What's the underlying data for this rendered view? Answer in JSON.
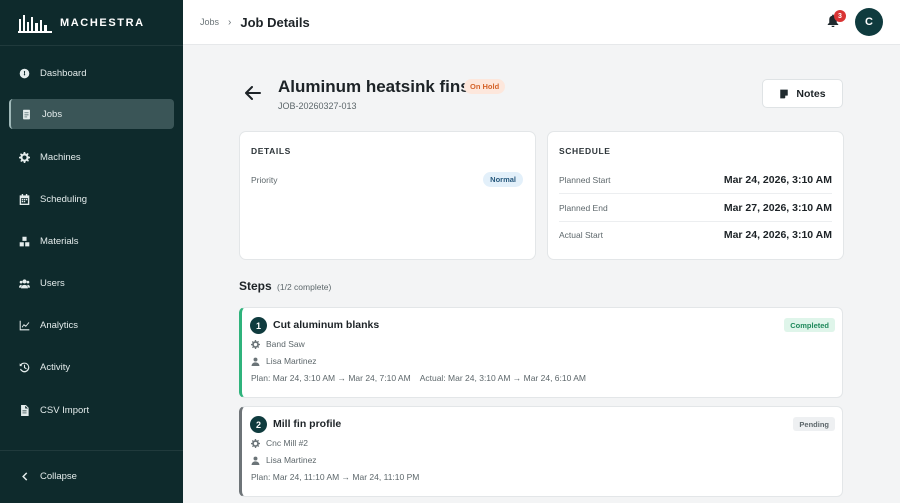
{
  "brand": {
    "name": "MACHESTRA",
    "logo_icon": "factory-skyline-icon"
  },
  "sidebar": {
    "items": [
      {
        "label": "Dashboard",
        "icon": "gauge-icon",
        "active": false
      },
      {
        "label": "Jobs",
        "icon": "clipboard-icon",
        "active": true
      },
      {
        "label": "Machines",
        "icon": "gear-icon",
        "active": false
      },
      {
        "label": "Scheduling",
        "icon": "calendar-icon",
        "active": false
      },
      {
        "label": "Materials",
        "icon": "boxes-icon",
        "active": false
      },
      {
        "label": "Users",
        "icon": "users-icon",
        "active": false
      },
      {
        "label": "Analytics",
        "icon": "chart-line-icon",
        "active": false
      },
      {
        "label": "Activity",
        "icon": "history-icon",
        "active": false
      },
      {
        "label": "CSV Import",
        "icon": "file-icon",
        "active": false
      }
    ],
    "collapse_label": "Collapse"
  },
  "topbar": {
    "breadcrumb_parent": "Jobs",
    "breadcrumb_current": "Job Details",
    "notification_count": "3",
    "avatar_initial": "C"
  },
  "job": {
    "title": "Aluminum heatsink fins",
    "status": "On Hold",
    "id": "JOB-20260327-013",
    "notes_label": "Notes"
  },
  "details": {
    "title": "DETAILS",
    "priority_label": "Priority",
    "priority_value": "Normal"
  },
  "schedule": {
    "title": "SCHEDULE",
    "rows": [
      {
        "label": "Planned Start",
        "value": "Mar 24, 2026, 3:10 AM"
      },
      {
        "label": "Planned End",
        "value": "Mar 27, 2026, 3:10 AM"
      },
      {
        "label": "Actual Start",
        "value": "Mar 24, 2026, 3:10 AM"
      }
    ]
  },
  "steps": {
    "heading": "Steps",
    "count": "(1/2 complete)",
    "items": [
      {
        "number": "1",
        "name": "Cut aluminum blanks",
        "status": "Completed",
        "machine": "Band Saw",
        "operator": "Lisa Martinez",
        "plan": "Plan: Mar 24, 3:10 AM → Mar 24, 7:10 AM",
        "actual": "Actual: Mar 24, 3:10 AM → Mar 24, 6:10 AM"
      },
      {
        "number": "2",
        "name": "Mill fin profile",
        "status": "Pending",
        "machine": "Cnc Mill #2",
        "operator": "Lisa Martinez",
        "plan": "Plan: Mar 24, 11:10 AM → Mar 24, 11:10 PM",
        "actual": ""
      }
    ]
  },
  "colors": {
    "sidebar_bg": "#0e2a2c",
    "accent": "#0f3b3e",
    "on_hold": "#d4632a",
    "completed": "#2fb37c",
    "badge_red": "#d93434"
  }
}
